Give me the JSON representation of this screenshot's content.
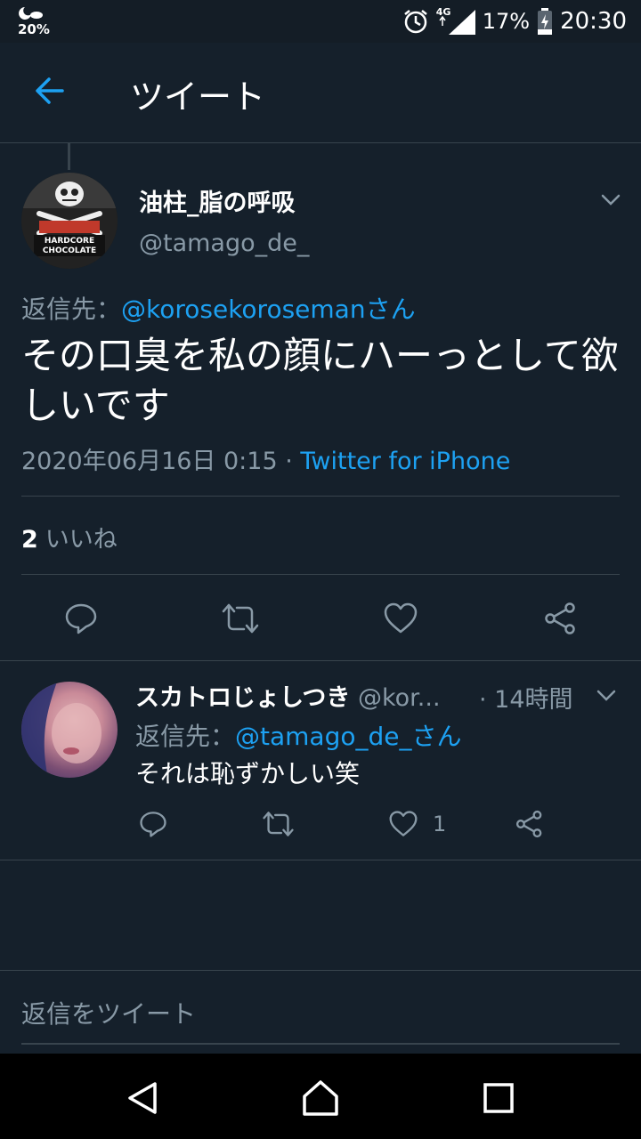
{
  "status_bar": {
    "weather_percent": "20%",
    "network": "4G",
    "battery": "17%",
    "time": "20:30"
  },
  "header": {
    "title": "ツイート"
  },
  "main_tweet": {
    "display_name": "油柱_脂の呼吸",
    "handle": "@tamago_de_",
    "reply_prefix": "返信先：",
    "reply_to": "@korosekorosemanさん",
    "text": "その口臭を私の顔にハーっとして欲しいです",
    "timestamp": "2020年06月16日 0:15",
    "separator": " · ",
    "client": "Twitter for iPhone",
    "likes_count": "2",
    "likes_label": "いいね",
    "avatar_text": "HARDCORE CHOCOLATE"
  },
  "reply_tweet": {
    "display_name": "スカトロじょしつき",
    "handle": "@kor...",
    "time": "· 14時間",
    "reply_prefix": "返信先：",
    "reply_to": "@tamago_de_さん",
    "text": "それは恥ずかしい笑",
    "like_count": "1"
  },
  "composer": {
    "placeholder": "返信をツイート"
  },
  "colors": {
    "background": "#15202b",
    "accent": "#1da1f2",
    "secondary_text": "#8899a6",
    "divider": "#38444d"
  }
}
